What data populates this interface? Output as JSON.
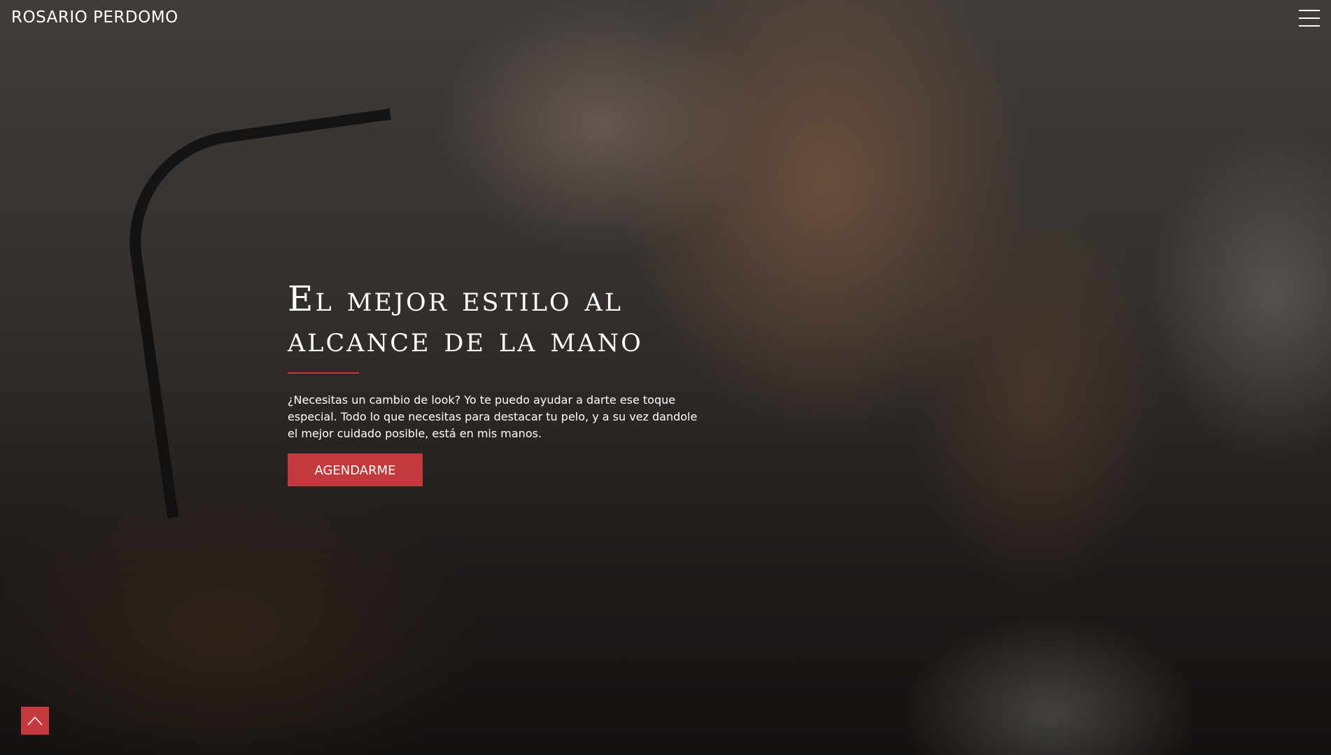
{
  "brand": {
    "name": "ROSARIO PERDOMO"
  },
  "header": {
    "menu_icon": "hamburger-menu-icon"
  },
  "hero": {
    "headline": "El mejor estilo al alcance de la mano",
    "lead": "¿Necesitas un cambio de look? Yo te puedo ayudar a darte ese toque especial. Todo lo que necesitas para destacar tu pelo, y a su vez dandole el mejor cuidado posible, está en mis manos.",
    "cta_label": "AGENDARME"
  },
  "back_to_top": {
    "icon": "chevron-up-icon"
  },
  "colors": {
    "accent": "#c4393c",
    "text": "#ffffff"
  }
}
